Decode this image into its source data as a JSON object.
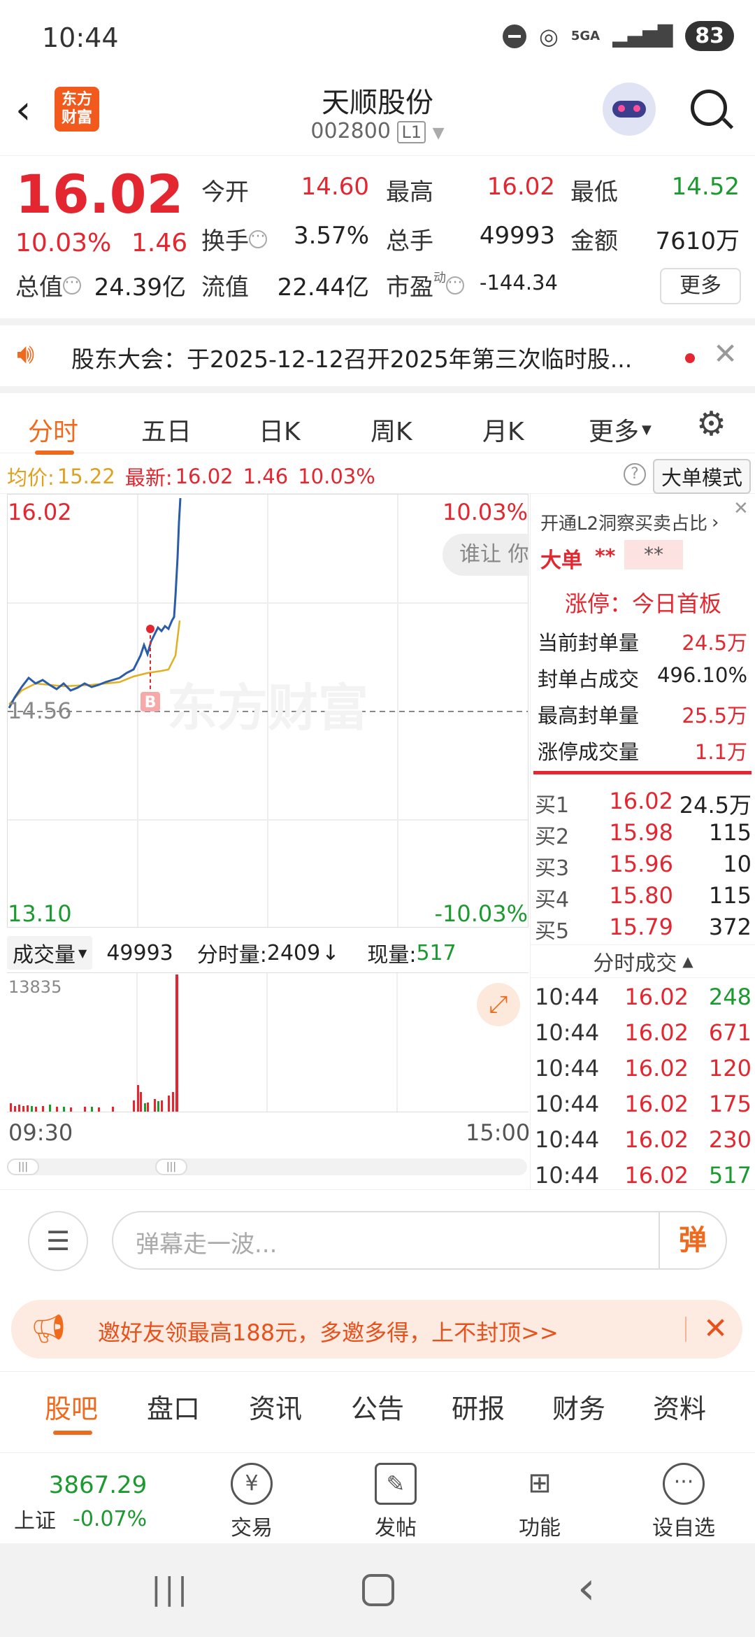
{
  "status_bar": {
    "time": "10:44",
    "network": "5GA",
    "battery": "83"
  },
  "header": {
    "logo_text": "东方财富",
    "stock_name": "天顺股份",
    "stock_code": "002800",
    "level": "L1"
  },
  "quote": {
    "price": "16.02",
    "change_pct": "10.03%",
    "change": "1.46",
    "open_label": "今开",
    "open": "14.60",
    "high_label": "最高",
    "high": "16.02",
    "low_label": "最低",
    "low": "14.52",
    "turnover_label": "换手",
    "turnover": "3.57%",
    "volume_label": "总手",
    "volume": "49993",
    "amount_label": "金额",
    "amount": "7610万",
    "mktcap_label": "总值",
    "mktcap": "24.39亿",
    "float_label": "流值",
    "float": "22.44亿",
    "pe_label": "市盈",
    "pe_sup": "动",
    "pe": "-144.34",
    "more_label": "更多"
  },
  "notice": {
    "text": "股东大会：于2025-12-12召开2025年第三次临时股..."
  },
  "tabs": [
    "分时",
    "五日",
    "日K",
    "周K",
    "月K",
    "更多"
  ],
  "info_line": {
    "avg_label": "均价:",
    "avg": "15.22",
    "latest_label": "最新:",
    "latest": "16.02",
    "latest_change": "1.46",
    "latest_pct": "10.03%",
    "big_order_mode": "大单模式"
  },
  "chart": {
    "y_top": "16.02",
    "y_top_pct": "10.03%",
    "y_mid": "14.56",
    "y_bottom": "13.10",
    "y_bottom_pct": "-10.03%",
    "watermark": "东方财富",
    "buy_marker": "B",
    "bubble_text": "谁让 你"
  },
  "volume_bar": {
    "selector": "成交量",
    "total": "49993",
    "minute_label": "分时量:",
    "minute_vol": "2409",
    "current_label": "现量:",
    "current_vol": "517",
    "max": "13835",
    "time_start": "09:30",
    "time_end": "15:00"
  },
  "right_panel": {
    "l2_promo": "开通L2洞察买卖占比",
    "big_label": "大单",
    "big_val1": "**",
    "big_val2": "**",
    "limit_title": "涨停：今日首板",
    "stats": [
      {
        "label": "当前封单量",
        "value": "24.5万"
      },
      {
        "label": "封单占成交",
        "value": "496.10%"
      },
      {
        "label": "最高封单量",
        "value": "25.5万"
      },
      {
        "label": "涨停成交量",
        "value": "1.1万"
      }
    ],
    "order_book": [
      {
        "level": "买1",
        "price": "16.02",
        "vol": "24.5万"
      },
      {
        "level": "买2",
        "price": "15.98",
        "vol": "115"
      },
      {
        "level": "买3",
        "price": "15.96",
        "vol": "10"
      },
      {
        "level": "买4",
        "price": "15.80",
        "vol": "115"
      },
      {
        "level": "买5",
        "price": "15.79",
        "vol": "372"
      }
    ],
    "trades_title": "分时成交",
    "trades": [
      {
        "time": "10:44",
        "price": "16.02",
        "vol": "248"
      },
      {
        "time": "10:44",
        "price": "16.02",
        "vol": "671"
      },
      {
        "time": "10:44",
        "price": "16.02",
        "vol": "120"
      },
      {
        "time": "10:44",
        "price": "16.02",
        "vol": "175"
      },
      {
        "time": "10:44",
        "price": "16.02",
        "vol": "230"
      },
      {
        "time": "10:44",
        "price": "16.02",
        "vol": "517"
      }
    ]
  },
  "comment": {
    "placeholder": "弹幕走一波...",
    "send_label": "弹"
  },
  "promo": {
    "text": "邀好友领最高188元，多邀多得，上不封顶>>"
  },
  "lower_tabs": [
    "股吧",
    "盘口",
    "资讯",
    "公告",
    "研报",
    "财务",
    "资料"
  ],
  "bottom_nav": {
    "index_value": "3867.29",
    "index_name": "上证",
    "index_change": "-0.07%",
    "items": [
      "交易",
      "发帖",
      "功能",
      "设自选"
    ]
  },
  "colors": {
    "up": "#e3262f",
    "down": "#1a9a2f",
    "accent": "#f06a1d",
    "avg_line": "#e0b020",
    "price_line": "#2a5ca8"
  }
}
